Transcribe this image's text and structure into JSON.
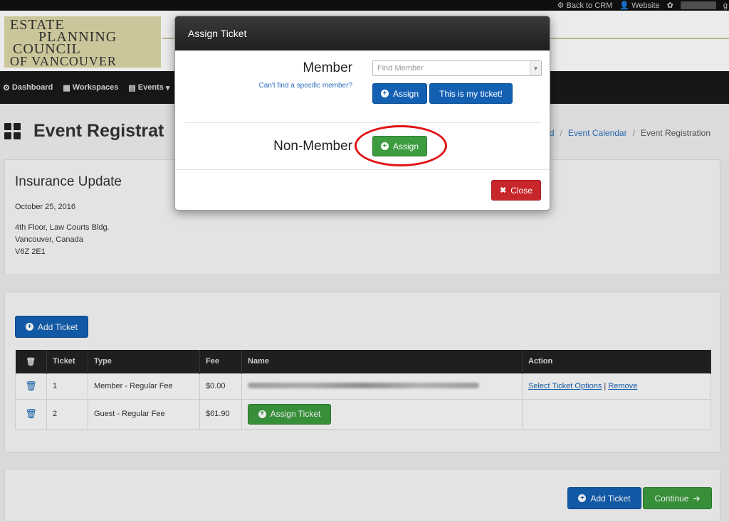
{
  "topbar": {
    "back_to_crm": "Back to CRM",
    "website": "Website",
    "user_suffix": "g"
  },
  "logo": {
    "line1": "ESTATE",
    "line2": "PLANNING",
    "line3": "COUNCIL",
    "line4": "OF VANCOUVER"
  },
  "nav": {
    "dashboard": "Dashboard",
    "workspaces": "Workspaces",
    "events": "Events"
  },
  "page": {
    "title": "Event Registrat"
  },
  "breadcrumb": {
    "prev_fragment": "d",
    "event_calendar": "Event Calendar",
    "current": "Event Registration"
  },
  "event": {
    "title": "Insurance Update",
    "date": "October 25, 2016",
    "address_line1": "4th Floor, Law Courts Bldg.",
    "address_line2": "Vancouver, Canada",
    "address_line3": "V6Z 2E1"
  },
  "tickets": {
    "add_ticket_label": "Add Ticket",
    "columns": {
      "ticket": "Ticket",
      "type": "Type",
      "fee": "Fee",
      "name": "Name",
      "action": "Action"
    },
    "rows": [
      {
        "ticket": "1",
        "type": "Member - Regular Fee",
        "fee": "$0.00",
        "select_options": "Select Ticket Options",
        "separator": "|",
        "remove": "Remove"
      },
      {
        "ticket": "2",
        "type": "Guest - Regular Fee",
        "fee": "$61.90",
        "assign_ticket": "Assign Ticket"
      }
    ]
  },
  "footer": {
    "add_ticket_label": "Add Ticket",
    "continue_label": "Continue"
  },
  "modal": {
    "title": "Assign Ticket",
    "member_label": "Member",
    "cant_find": "Can't find a specific member?",
    "find_member_placeholder": "Find Member",
    "assign_label": "Assign",
    "this_is_my_ticket": "This is my ticket!",
    "non_member_label": "Non-Member",
    "assign_nonmember_label": "Assign",
    "close_label": "Close"
  },
  "colors": {
    "primary_blue": "#1360b3",
    "success_green": "#3c9c3f",
    "danger_red": "#c7262a",
    "highlight_circle": "#e01414"
  }
}
